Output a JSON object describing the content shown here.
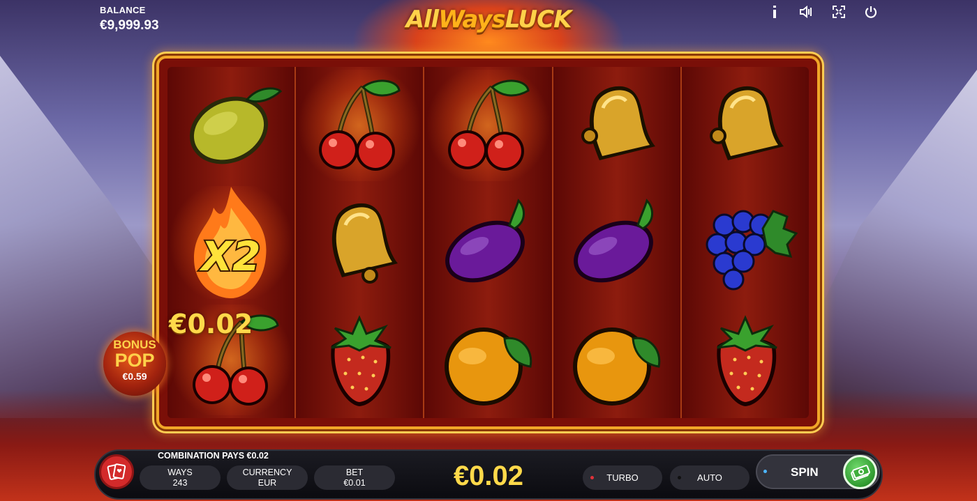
{
  "header": {
    "balance_label": "BALANCE",
    "balance_value": "€9,999.93",
    "logo_part1": "All",
    "logo_part2": "Ways",
    "logo_part3": "LUCK",
    "icons": [
      "info-icon",
      "sound-icon",
      "fullscreen-icon",
      "power-icon"
    ]
  },
  "reels": [
    [
      "lemon",
      "multiplier-x2",
      "cherry"
    ],
    [
      "cherry",
      "bell",
      "strawberry"
    ],
    [
      "cherry",
      "plum",
      "orange"
    ],
    [
      "bell",
      "plum",
      "orange"
    ],
    [
      "bell",
      "grapes",
      "strawberry"
    ]
  ],
  "highlighted_cells": [
    "0-2",
    "1-0",
    "2-0"
  ],
  "multiplier_label": "X2",
  "win_amount": "€0.02",
  "bonus_pop": {
    "line1": "BONUS",
    "line2": "POP",
    "amount": "€0.59"
  },
  "bottom_bar": {
    "combination_text": "COMBINATION PAYS €0.02",
    "ways_label": "WAYS",
    "ways_value": "243",
    "currency_label": "CURRENCY",
    "currency_value": "EUR",
    "bet_label": "BET",
    "bet_value": "€0.01",
    "total_win": "€0.02",
    "turbo_label": "TURBO",
    "auto_label": "AUTO",
    "spin_label": "SPIN"
  },
  "colors": {
    "gold": "#ffd94a",
    "frame": "#f1a628",
    "turbo_dot": "#e0323a",
    "auto_dot": "#111111",
    "spin_dot": "#4db6ff"
  }
}
